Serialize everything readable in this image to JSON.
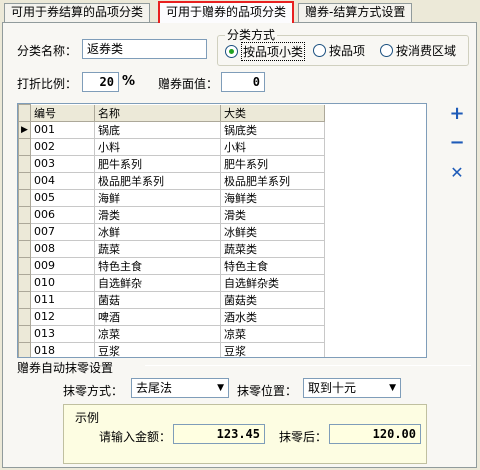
{
  "tabs": [
    {
      "label": "可用于券结算的品项分类"
    },
    {
      "label": "可用于赠券的品项分类"
    },
    {
      "label": "赠券-结算方式设置"
    }
  ],
  "form": {
    "category_name_label": "分类名称：",
    "category_name_value": "返券类",
    "discount_label": "打折比例：",
    "discount_value": "20",
    "discount_unit": "%",
    "face_value_label": "赠券面值：",
    "face_value_value": "0"
  },
  "classify": {
    "title": "分类方式",
    "options": [
      {
        "label": "按品项小类",
        "selected": true
      },
      {
        "label": "按品项",
        "selected": false
      },
      {
        "label": "按消费区域",
        "selected": false
      }
    ]
  },
  "grid": {
    "columns": [
      "编号",
      "名称",
      "大类"
    ],
    "current_row_marker": "▶",
    "rows": [
      [
        "001",
        "锅底",
        "锅底类"
      ],
      [
        "002",
        "小料",
        "小料"
      ],
      [
        "003",
        "肥牛系列",
        "肥牛系列"
      ],
      [
        "004",
        "极品肥羊系列",
        "极品肥羊系列"
      ],
      [
        "005",
        "海鲜",
        "海鲜类"
      ],
      [
        "006",
        "滑类",
        "滑类"
      ],
      [
        "007",
        "冰鲜",
        "冰鲜类"
      ],
      [
        "008",
        "蔬菜",
        "蔬菜类"
      ],
      [
        "009",
        "特色主食",
        "特色主食"
      ],
      [
        "010",
        "自选鲜杂",
        "自选鲜杂类"
      ],
      [
        "011",
        "菌菇",
        "菌菇类"
      ],
      [
        "012",
        "啤酒",
        "酒水类"
      ],
      [
        "013",
        "凉菜",
        "凉菜"
      ],
      [
        "018",
        "豆浆",
        "豆浆"
      ]
    ]
  },
  "side_buttons": {
    "add": "+",
    "remove": "−",
    "delete": "✕"
  },
  "rounding": {
    "title": "赠券自动抹零设置",
    "mode_label": "抹零方式：",
    "mode_value": "去尾法",
    "position_label": "抹零位置：",
    "position_value": "取到十元"
  },
  "example": {
    "title": "示例",
    "input_label": "请输入金额：",
    "input_value": "123.45",
    "result_label": "抹零后：",
    "result_value": "120.00"
  },
  "colors": {
    "accent_blue": "#1e5bb8",
    "active_tab_border": "#e8201f",
    "radio_dot": "#21a121"
  }
}
